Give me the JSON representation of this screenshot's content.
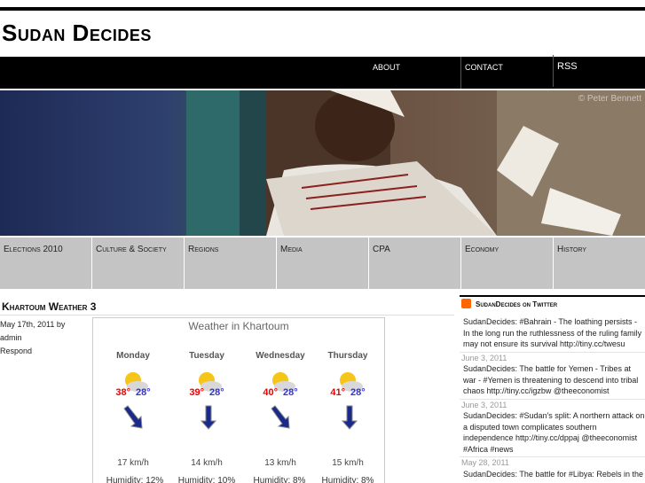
{
  "site": {
    "title": "Sudan Decides"
  },
  "nav": {
    "about": "ABOUT",
    "contact": "CONTACT",
    "rss": "RSS"
  },
  "hero": {
    "credit": "© Peter Bennett"
  },
  "categories": [
    "Elections 2010",
    "Culture & Society",
    "Regions",
    "Media",
    "CPA",
    "Economy",
    "History"
  ],
  "post": {
    "title": "Khartoum Weather 3",
    "date_line": "May 17th, 2011 by",
    "author": "admin",
    "respond": "Respond"
  },
  "weather": {
    "title": "Weather in Khartoum",
    "days": [
      {
        "name": "Monday",
        "high": "38°",
        "low": "28°",
        "wind": "17 km/h",
        "humidity": "Humidity: 12%"
      },
      {
        "name": "Tuesday",
        "high": "39°",
        "low": "28°",
        "wind": "14 km/h",
        "humidity": "Humidity: 10%"
      },
      {
        "name": "Wednesday",
        "high": "40°",
        "low": "28°",
        "wind": "13 km/h",
        "humidity": "Humidity: 8%"
      },
      {
        "name": "Thursday",
        "high": "41°",
        "low": "28°",
        "wind": "15 km/h",
        "humidity": "Humidity: 8%"
      }
    ]
  },
  "sidebar": {
    "heading": "SudanDecides on Twitter",
    "tweets": [
      {
        "text": "SudanDecides: #Bahrain - The loathing persists - In the long run the ruthlessness of the ruling family may not ensure its survival http://tiny.cc/twesu",
        "date": "June 3, 2011"
      },
      {
        "text": "SudanDecides: The battle for Yemen - Tribes at war - #Yemen is threatening to descend into tribal chaos http://tiny.cc/igzbw @theeconomist",
        "date": "June 3, 2011"
      },
      {
        "text": "SudanDecides: #Sudan's split: A northern attack on a disputed town complicates southern independence http://tiny.cc/dppaj @theeconomist #Africa #news",
        "date": "May 28, 2011"
      },
      {
        "text": "SudanDecides: The battle for #Libya: Rebels in the",
        "date": ""
      }
    ]
  },
  "colors": {
    "nav_bg": "#000000",
    "category_bg": "#c4c4c4",
    "high_temp": "#ee0000",
    "low_temp": "#3333cc"
  }
}
